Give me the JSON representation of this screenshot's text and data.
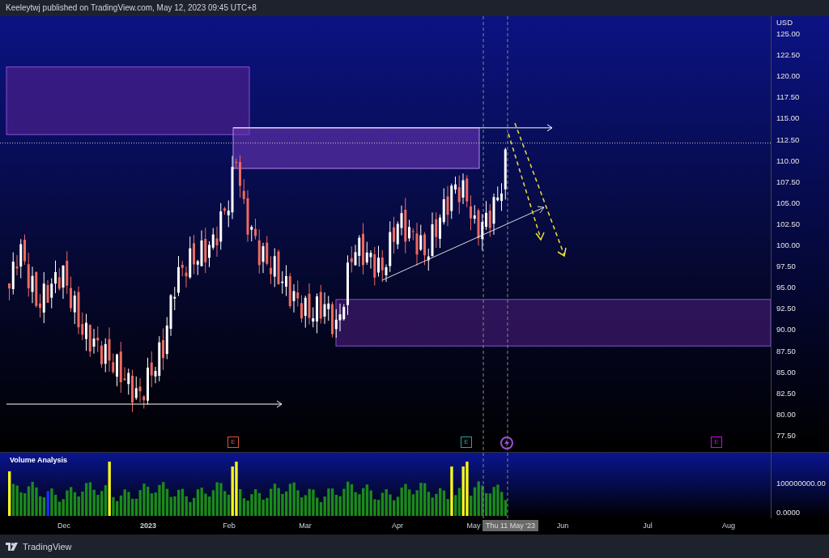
{
  "header": {
    "text": "Keeleytwj published on TradingView.com, May 12, 2023 09:45 UTC+8"
  },
  "price_axis": {
    "currency": "USD",
    "ticks": [
      "125.00",
      "122.50",
      "120.00",
      "117.50",
      "115.00",
      "112.50",
      "110.00",
      "107.50",
      "105.00",
      "102.50",
      "100.00",
      "97.50",
      "95.00",
      "92.50",
      "90.00",
      "87.50",
      "85.00",
      "82.50",
      "80.00",
      "77.50"
    ]
  },
  "markers": [
    {
      "kind": "earnings",
      "label": "E",
      "color": "#e0523b"
    },
    {
      "kind": "earnings",
      "label": "E",
      "color": "#26a69a"
    },
    {
      "kind": "lightning",
      "color": "#9c4fd6"
    },
    {
      "kind": "earnings",
      "label": "E",
      "color": "#d500f9"
    }
  ],
  "volume_pane": {
    "title": "Volume Analysis",
    "axis_ticks": [
      "100000000.00",
      "0.0000"
    ]
  },
  "time_axis": {
    "labels": [
      "Dec",
      "2023",
      "Feb",
      "Mar",
      "Apr",
      "May",
      "Jun",
      "Jul",
      "Aug"
    ],
    "crosshair_label": "Thu 11 May '23"
  },
  "footer": {
    "brand": "TradingView"
  }
}
